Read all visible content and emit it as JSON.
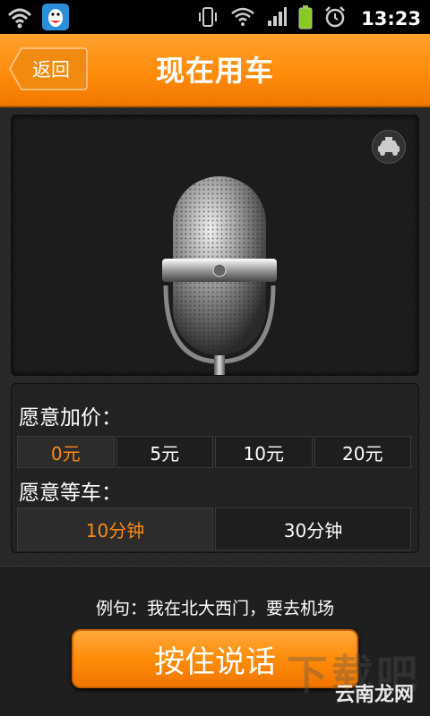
{
  "statusbar": {
    "time": "13:23"
  },
  "header": {
    "back_label": "返回",
    "title": "现在用车"
  },
  "options": {
    "price_label": "愿意加价：",
    "prices": [
      "0元",
      "5元",
      "10元",
      "20元"
    ],
    "selected_price": "0元",
    "wait_label": "愿意等车：",
    "waits": [
      "10分钟",
      "30分钟"
    ],
    "selected_wait": "10分钟"
  },
  "footer": {
    "example": "例句：我在北大西门，要去机场",
    "talk_button": "按住说话"
  },
  "watermark": {
    "text": "云南龙网",
    "big_text": "下载吧"
  },
  "colors": {
    "accent": "#ff8c0c",
    "selected_text": "#ff8a14"
  },
  "icons": {
    "status_left": [
      "wifi-icon",
      "qq-icon"
    ],
    "status_right": [
      "vibrate-icon",
      "wifi-signal-icon",
      "cell-signal-icon",
      "battery-icon",
      "alarm-icon"
    ],
    "mic": "microphone-icon",
    "taxi": "taxi-icon"
  }
}
